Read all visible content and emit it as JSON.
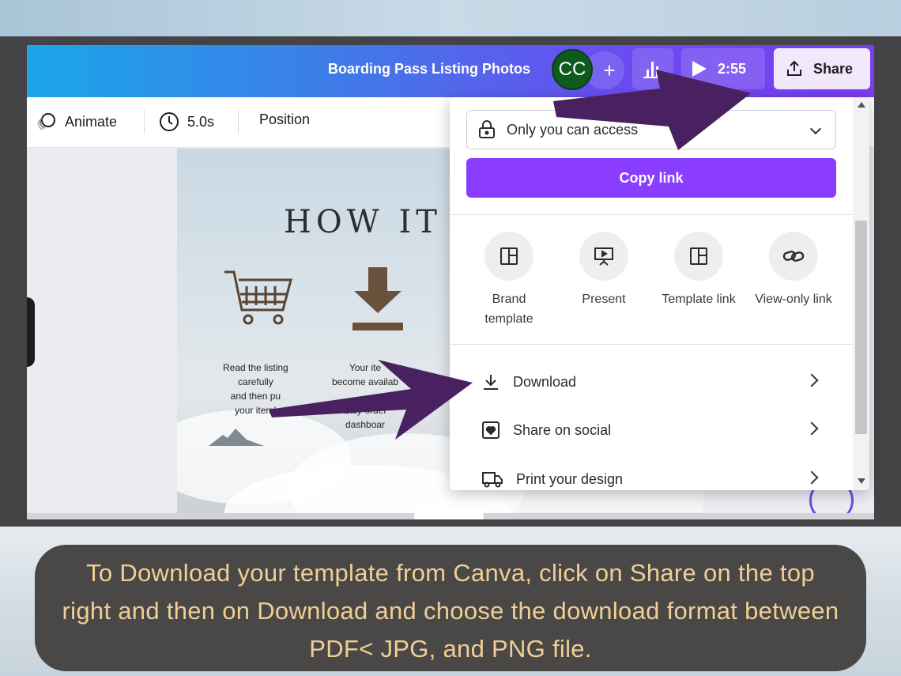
{
  "topbar": {
    "doc_title": "Boarding Pass Listing Photos",
    "avatar_initials": "CC",
    "add_label": "+",
    "timer": "2:55",
    "share_label": "Share"
  },
  "toolbar": {
    "animate_label": "Animate",
    "duration_label": "5.0s",
    "position_label": "Position"
  },
  "design": {
    "title": "HOW IT",
    "step1_lines": [
      "Read the listing",
      "carefully",
      "and then pu",
      "your item!"
    ],
    "step2_lines": [
      "Your ite",
      "become availab",
      "",
      "Etsy order",
      "dashboar"
    ]
  },
  "share_panel": {
    "access_value": "Only you can access",
    "copy_link_label": "Copy link",
    "options": [
      {
        "label_line1": "Brand",
        "label_line2": "template",
        "icon": "template-icon"
      },
      {
        "label_line1": "Present",
        "label_line2": "",
        "icon": "present-icon"
      },
      {
        "label_line1": "Template link",
        "label_line2": "",
        "icon": "template-link-icon"
      },
      {
        "label_line1": "View-only link",
        "label_line2": "",
        "icon": "link-icon"
      }
    ],
    "rows": [
      {
        "label": "Download",
        "icon": "download-icon"
      },
      {
        "label": "Share on social",
        "icon": "heart-icon"
      },
      {
        "label": "Print your design",
        "icon": "truck-icon"
      }
    ]
  },
  "caption": {
    "text": "To Download your template from Canva, click on Share on the top right and then on Download and choose the download format between PDF< JPG, and PNG file."
  },
  "colors": {
    "accent_purple": "#8b3dff",
    "arrow_purple": "#4a2160",
    "caption_text": "#f0cf96",
    "caption_bg": "#4a4846"
  }
}
